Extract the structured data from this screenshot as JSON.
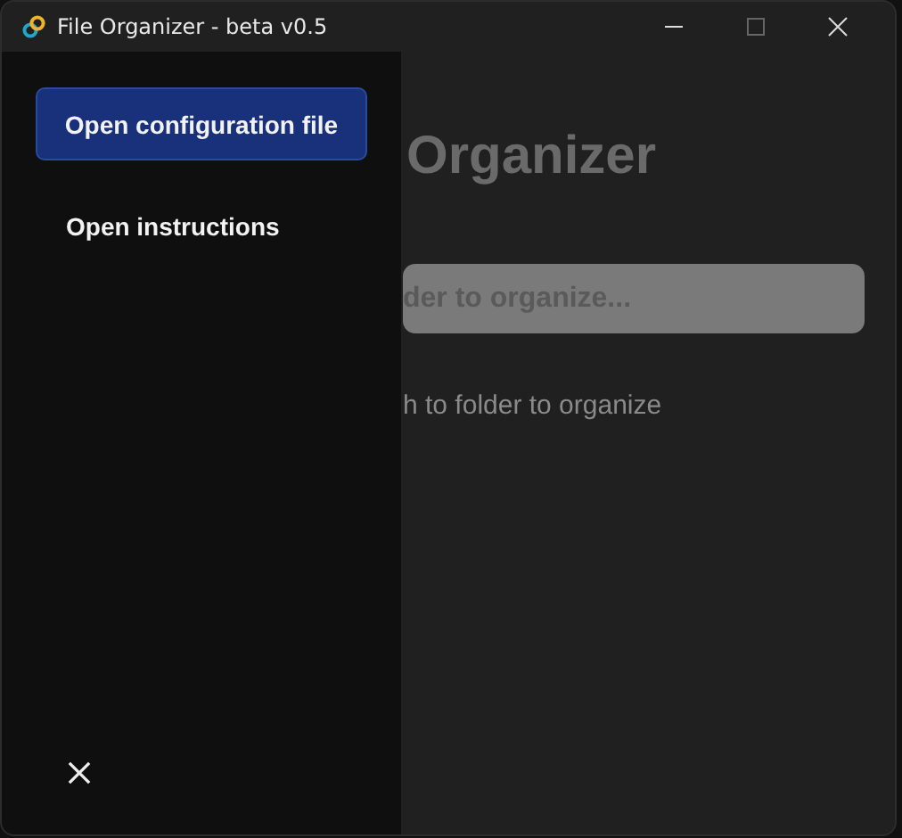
{
  "window": {
    "title": "File Organizer - beta v0.5"
  },
  "main": {
    "heading": "Organizer",
    "path_field": {
      "placeholder": "der to organize..."
    },
    "hint": "h to folder to organize"
  },
  "drawer": {
    "items": [
      {
        "label": "Open configuration file",
        "kind": "primary"
      },
      {
        "label": "Open instructions",
        "kind": "link"
      }
    ]
  }
}
